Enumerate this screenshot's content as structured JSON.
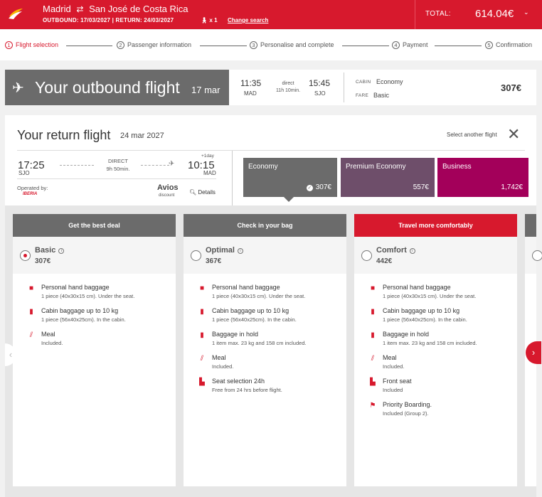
{
  "header": {
    "origin": "Madrid",
    "destination": "San José de Costa Rica",
    "outbound_label": "OUTBOUND: 17/03/2027",
    "return_label": "RETURN: 24/03/2027",
    "passengers": "x 1",
    "change_search": "Change search",
    "total_label": "TOTAL:",
    "total_amount": "614.04€"
  },
  "steps": [
    {
      "n": "1",
      "label": "Flight selection"
    },
    {
      "n": "2",
      "label": "Passenger information"
    },
    {
      "n": "3",
      "label": "Personalise and complete"
    },
    {
      "n": "4",
      "label": "Payment"
    },
    {
      "n": "5",
      "label": "Confirmation"
    }
  ],
  "outbound": {
    "title": "Your outbound flight",
    "date": "17 mar",
    "dep_time": "11:35",
    "dep_airport": "MAD",
    "stops": "direct",
    "duration": "11h 10min.",
    "arr_time": "15:45",
    "arr_airport": "SJO",
    "cabin_label": "CABIN",
    "cabin_value": "Economy",
    "fare_label": "FARE",
    "fare_value": "Basic",
    "price": "307€"
  },
  "return_flight": {
    "title": "Your return flight",
    "date": "24 mar 2027",
    "select_another": "Select another flight",
    "dep_time": "17:25",
    "dep_airport": "SJO",
    "stops": "DIRECT",
    "duration": "9h 50min.",
    "next_day": "+1day",
    "arr_time": "10:15",
    "arr_airport": "MAD",
    "operated_by": "Operated by:",
    "operator": "IBERIA",
    "avios": "Avios",
    "avios_sub": "discount",
    "details": "Details",
    "fares": [
      {
        "name": "Economy",
        "price": "307€",
        "color": "#6b6b6b"
      },
      {
        "name": "Premium Economy",
        "price": "557€",
        "color": "#6e4e6a"
      },
      {
        "name": "Business",
        "price": "1,742€",
        "color": "#a3005a"
      }
    ]
  },
  "fare_options": [
    {
      "header": "Get the best deal",
      "header_color": "#6b6b6b",
      "name": "Basic",
      "price": "307€",
      "selected": true,
      "features": [
        {
          "icon": "personal-bag-icon",
          "title": "Personal hand baggage",
          "sub": "1 piece (40x30x15 cm). Under the seat."
        },
        {
          "icon": "cabin-bag-icon",
          "title": "Cabin baggage up to 10 kg",
          "sub": "1 piece (56x40x25cm). In the cabin."
        },
        {
          "icon": "meal-icon",
          "title": "Meal",
          "sub": "Included."
        }
      ]
    },
    {
      "header": "Check in your bag",
      "header_color": "#6b6b6b",
      "name": "Optimal",
      "price": "367€",
      "selected": false,
      "features": [
        {
          "icon": "personal-bag-icon",
          "title": "Personal hand baggage",
          "sub": "1 piece (40x30x15 cm). Under the seat."
        },
        {
          "icon": "cabin-bag-icon",
          "title": "Cabin baggage up to 10 kg",
          "sub": "1 piece (56x40x25cm). In the cabin."
        },
        {
          "icon": "checked-bag-icon",
          "title": "Baggage in hold",
          "sub": "1 item max. 23 kg and 158 cm included."
        },
        {
          "icon": "meal-icon",
          "title": "Meal",
          "sub": "Included."
        },
        {
          "icon": "seat-selection-icon",
          "title": "Seat selection 24h",
          "sub": "Free from 24 hrs before flight."
        }
      ]
    },
    {
      "header": "Travel more comfortably",
      "header_color": "#d7192d",
      "name": "Comfort",
      "price": "442€",
      "selected": false,
      "features": [
        {
          "icon": "personal-bag-icon",
          "title": "Personal hand baggage",
          "sub": "1 piece (40x30x15 cm). Under the seat."
        },
        {
          "icon": "cabin-bag-icon",
          "title": "Cabin baggage up to 10 kg",
          "sub": "1 piece (56x40x25cm). In the cabin."
        },
        {
          "icon": "checked-bag-icon",
          "title": "Baggage in hold",
          "sub": "1 item max. 23 kg and 158 cm included."
        },
        {
          "icon": "meal-icon",
          "title": "Meal",
          "sub": "Included."
        },
        {
          "icon": "front-seat-icon",
          "title": "Front seat",
          "sub": "Included"
        },
        {
          "icon": "priority-boarding-icon",
          "title": "Priority Boarding.",
          "sub": "Included (Group 2)."
        }
      ]
    }
  ]
}
